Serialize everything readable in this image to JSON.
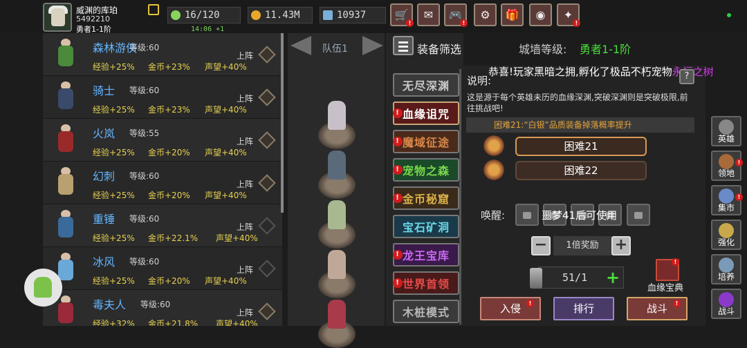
{
  "player": {
    "name": "威渊的库珀",
    "id": "5492210",
    "rank": "勇者1-1阶"
  },
  "resources": {
    "energy": "16/120",
    "energy_timer": "14:06 +1",
    "gold": "11.43M",
    "gems": "10937"
  },
  "top_buttons": [
    "shop-icon",
    "mail-icon",
    "gamepad-icon",
    "settings-icon",
    "gift-icon",
    "wheel-icon",
    "event-icon"
  ],
  "heroes": [
    {
      "name": "森林游侠",
      "level": "等级:60",
      "deploy": "上阵",
      "exp": "经验+25%",
      "gold": "金币+23%",
      "fame": "声望+40%"
    },
    {
      "name": "骑士",
      "level": "等级:60",
      "deploy": "上阵",
      "exp": "经验+25%",
      "gold": "金币+23%",
      "fame": "声望+40%"
    },
    {
      "name": "火岚",
      "level": "等级:55",
      "deploy": "上阵",
      "exp": "经验+25%",
      "gold": "金币+20%",
      "fame": "声望+40%"
    },
    {
      "name": "幻刺",
      "level": "等级:60",
      "deploy": "上阵",
      "exp": "经验+25%",
      "gold": "金币+20%",
      "fame": "声望+40%"
    },
    {
      "name": "重锤",
      "level": "等级:60",
      "deploy": "上阵",
      "exp": "经验+25%",
      "gold": "金币+22.1%",
      "fame": "声望+40%"
    },
    {
      "name": "冰风",
      "level": "等级:60",
      "deploy": "上阵",
      "exp": "经验+25%",
      "gold": "金币+20%",
      "fame": "声望+40%"
    },
    {
      "name": "毒夫人",
      "level": "等级:60",
      "deploy": "上阵",
      "exp": "经验+32%",
      "gold": "金币+21.8%",
      "fame": "声望+40%"
    }
  ],
  "team": {
    "label": "队伍1"
  },
  "filter": {
    "label": "装备筛选",
    "wall_label": "城墙等级:",
    "wall_value": "勇者1-1阶"
  },
  "dungeons": [
    "无尽深渊",
    "血缘诅咒",
    "魔域征途",
    "宠物之森",
    "金币秘窟",
    "宝石矿洞",
    "龙王宝库",
    "世界首领",
    "木桩模式"
  ],
  "banner": {
    "text": "恭喜!玩家黑暗之拥,孵化了极品不朽宠物",
    "highlight": "永恒之树"
  },
  "panel": {
    "desc_label": "说明:",
    "help": "?",
    "desc": "这是源于每个英雄未历的血缘深渊,突破深渊则是突破极限,前往挑战吧!",
    "tip": "困难21:“白银”品质装备掉落概率提升",
    "difficulties": [
      "困难21",
      "困难22"
    ],
    "awaken_label": "唤醒:",
    "awaken_text": "噩梦41后可使用",
    "minus": "−",
    "plus": "+",
    "bonus": "1倍奖励",
    "count": "51/1",
    "book_label": "血缘宝典",
    "actions": [
      "入侵",
      "排行",
      "战斗"
    ]
  },
  "menu": [
    "英雄",
    "领地",
    "集市",
    "强化",
    "培养",
    "战斗"
  ],
  "colors": {
    "accent_gold": "#e8d250",
    "hero_name": "#63b5ff",
    "green": "#4ade3a",
    "alert": "#d21b1b"
  }
}
